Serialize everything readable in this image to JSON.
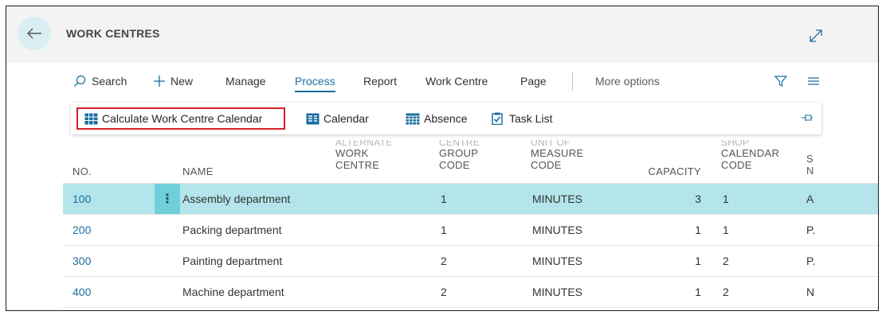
{
  "page": {
    "title": "WORK CENTRES"
  },
  "actions": {
    "search": "Search",
    "new": "New",
    "manage": "Manage",
    "process": "Process",
    "report": "Report",
    "work_centre": "Work Centre",
    "page": "Page",
    "more_options": "More options"
  },
  "process_actions": {
    "calculate": "Calculate Work Centre Calendar",
    "calendar": "Calendar",
    "absence": "Absence",
    "task_list": "Task List"
  },
  "columns": {
    "no": "NO.",
    "name": "NAME",
    "alternate_hidden": "ALTERNATE",
    "alternate": "WORK CENTRE",
    "group_hidden": "CENTRE",
    "group_line1": "GROUP",
    "group_line2": "CODE",
    "uom_hidden": "UNIT OF",
    "uom_line1": "MEASURE",
    "uom_line2": "CODE",
    "capacity": "CAPACITY",
    "shop_hidden": "SHOP",
    "shop_line1": "CALENDAR",
    "shop_line2": "CODE",
    "next_line1": "S",
    "next_line2": "N"
  },
  "rows": [
    {
      "no": "100",
      "name": "Assembly department",
      "group": "1",
      "uom": "MINUTES",
      "capacity": "3",
      "calendar": "1",
      "next": "A"
    },
    {
      "no": "200",
      "name": "Packing department",
      "group": "1",
      "uom": "MINUTES",
      "capacity": "1",
      "calendar": "1",
      "next": "P."
    },
    {
      "no": "300",
      "name": "Painting department",
      "group": "2",
      "uom": "MINUTES",
      "capacity": "1",
      "calendar": "2",
      "next": "P."
    },
    {
      "no": "400",
      "name": "Machine department",
      "group": "2",
      "uom": "MINUTES",
      "capacity": "1",
      "calendar": "2",
      "next": "N"
    }
  ],
  "colors": {
    "accent": "#1b6ea0",
    "selected_row": "#b3e5ea",
    "highlight_box": "#d92027"
  }
}
